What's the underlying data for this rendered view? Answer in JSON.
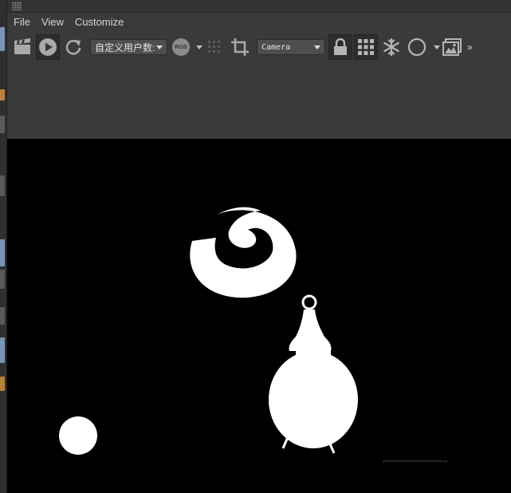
{
  "menu": {
    "file": "File",
    "view": "View",
    "customize": "Customize"
  },
  "toolbar": {
    "user_dropdown_value": "自定义用户数:",
    "rgb_label": "RGB",
    "camera_dropdown_value": "Camera",
    "overflow": "»"
  },
  "icons": [
    "clapper-icon",
    "play-icon",
    "refresh-icon",
    "rgb-icon",
    "dot-grid-icon",
    "crop-icon",
    "lock-icon",
    "grid-icon",
    "snowflake-icon",
    "circle-icon",
    "image-icon"
  ],
  "colors": {
    "background": "#3a3a3a",
    "viewport": "#000000",
    "mask_white": "#ffffff"
  }
}
